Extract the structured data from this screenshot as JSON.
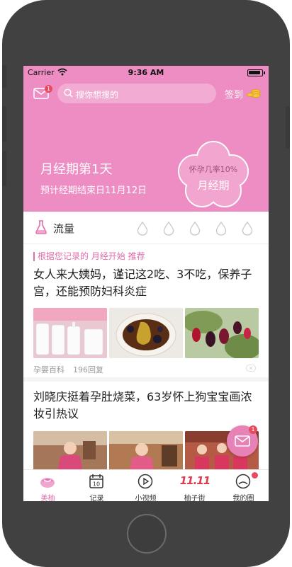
{
  "status_bar": {
    "carrier": "Carrier",
    "time": "9:36 AM"
  },
  "header": {
    "mail_badge": "1",
    "search_placeholder": "搜你想搜的",
    "signin_label": "签到",
    "period_day": "月经期第1天",
    "period_end": "预计经期结束日11月12日",
    "pregnancy_rate": "怀孕几率10%",
    "phase": "月经期"
  },
  "flow": {
    "label": "流量",
    "drops": 5
  },
  "feed": {
    "recommend_label": "根据您记录的 月经开始 推荐",
    "posts": [
      {
        "title": "女人来大姨妈，谨记这2吃、3不吃，保养子宫，还能预防妇科炎症",
        "source": "孕婴百科",
        "replies": "196回复"
      },
      {
        "title": "刘晓庆挺着孕肚烧菜，63岁怀上狗宝宝画浓妆引热议"
      }
    ]
  },
  "fab_badge": "1",
  "tabs": [
    {
      "label": "美柚",
      "icon": "bowl-icon",
      "active": true
    },
    {
      "label": "记录",
      "icon": "calendar-icon"
    },
    {
      "label": "小视频",
      "icon": "play-icon"
    },
    {
      "label": "柚子街",
      "icon": "double-eleven-icon",
      "mark": "11.11"
    },
    {
      "label": "我的圈",
      "icon": "profile-icon"
    }
  ],
  "colors": {
    "brand_pink": "#ee8dc3",
    "accent_pink": "#e06da9",
    "badge_red": "#e84b5f"
  }
}
